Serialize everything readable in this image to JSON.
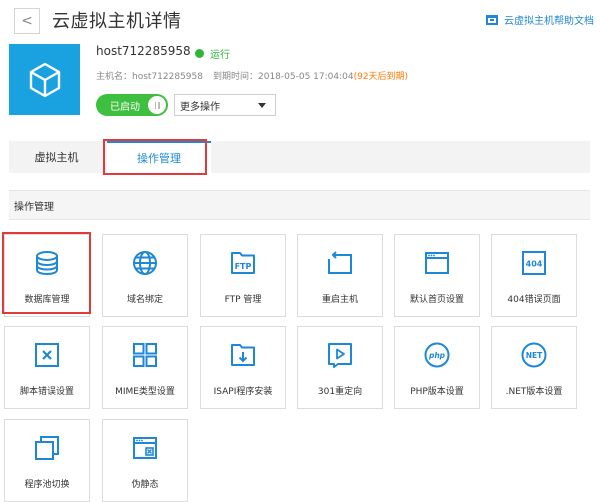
{
  "header": {
    "back_glyph": "<",
    "title": "云虚拟主机详情",
    "help_link": "云虚拟主机帮助文档"
  },
  "host": {
    "name": "host712285958",
    "status": "运行",
    "meta_prefix": "主机名：",
    "meta_name": "host712285958",
    "meta_expire_prefix": "到期时间：",
    "meta_expire": "2018-05-05 17:04:04",
    "meta_expire_note": "(92天后到期)",
    "toggle_label": "已启动",
    "more_ops": "更多操作"
  },
  "tabs": [
    {
      "label": "虚拟主机",
      "active": false
    },
    {
      "label": "操作管理",
      "active": true
    }
  ],
  "section_title": "操作管理",
  "tiles": [
    {
      "label": "数据库管理",
      "icon": "database-icon"
    },
    {
      "label": "域名绑定",
      "icon": "globe-icon"
    },
    {
      "label": "FTP 管理",
      "icon": "ftp-folder-icon",
      "icon_text": "FTP"
    },
    {
      "label": "重启主机",
      "icon": "restart-icon"
    },
    {
      "label": "默认首页设置",
      "icon": "browser-window-icon"
    },
    {
      "label": "404错误页面",
      "icon": "error-404-icon",
      "icon_text": "404"
    },
    {
      "label": "脚本错误设置",
      "icon": "close-box-icon"
    },
    {
      "label": "MIME类型设置",
      "icon": "grid-icon"
    },
    {
      "label": "ISAPI程序安装",
      "icon": "download-box-icon"
    },
    {
      "label": "301重定向",
      "icon": "redirect-play-icon"
    },
    {
      "label": "PHP版本设置",
      "icon": "php-icon",
      "icon_text": "php"
    },
    {
      "label": ".NET版本设置",
      "icon": "dotnet-icon",
      "icon_text": "NET"
    },
    {
      "label": "程序池切换",
      "icon": "app-pool-icon"
    },
    {
      "label": "伪静态",
      "icon": "rewrite-window-icon"
    }
  ],
  "colors": {
    "accent_blue": "#1e88d6",
    "logo_blue": "#1aa1e0",
    "running_green": "#2db63a",
    "toggle_green": "#3fbf3f",
    "warn_orange": "#ff7a00",
    "highlight_red": "#e03a3a"
  }
}
